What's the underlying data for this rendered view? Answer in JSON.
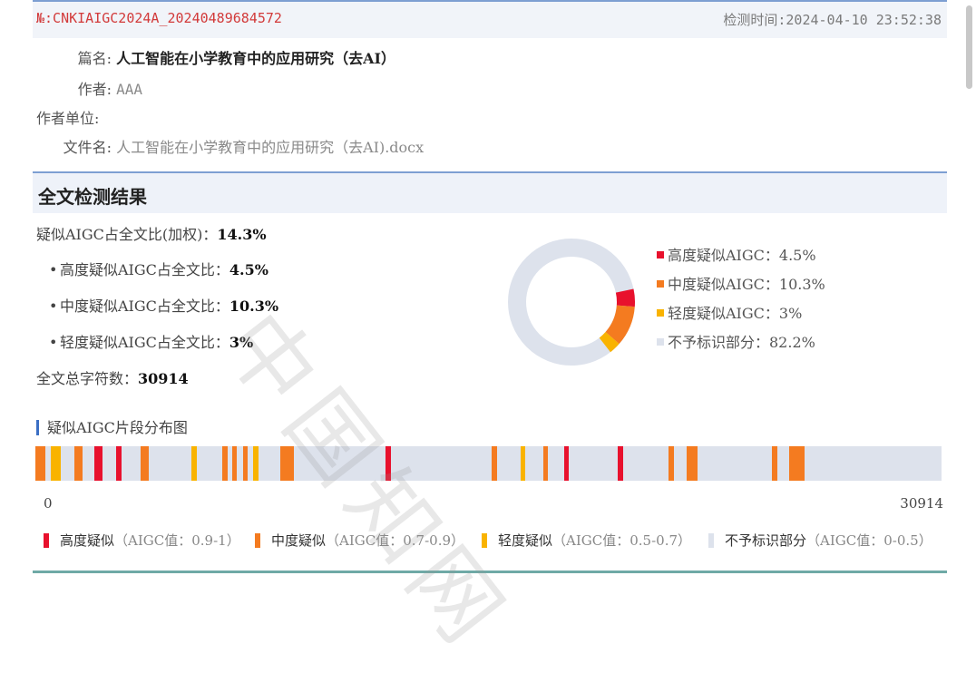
{
  "header": {
    "report_no": "№:CNKIAIGC2024A_20240489684572",
    "detect_time": "检测时间:2024-04-10 23:52:38"
  },
  "info": {
    "title_label": "篇名:",
    "title_value": "人工智能在小学教育中的应用研究（去AI）",
    "author_label": "作者:",
    "author_value": "AAA",
    "unit_label": "作者单位:",
    "unit_value": "",
    "file_label": "文件名:",
    "file_value": "人工智能在小学教育中的应用研究（去AI).docx"
  },
  "section": {
    "title": "全文检测结果"
  },
  "stats": {
    "weighted_label": "疑似AIGC占全文比(加权)：",
    "weighted_value": "14.3%",
    "high_label": "高度疑似AIGC占全文比：",
    "high_value": "4.5%",
    "mid_label": "中度疑似AIGC占全文比：",
    "mid_value": "10.3%",
    "low_label": "轻度疑似AIGC占全文比：",
    "low_value": "3%",
    "chars_label": "全文总字符数：",
    "chars_value": "30914"
  },
  "donut_legend": [
    {
      "label": "高度疑似AIGC：4.5%",
      "color": "#e8112d",
      "value": 4.5
    },
    {
      "label": "中度疑似AIGC：10.3%",
      "color": "#f47b20",
      "value": 10.3
    },
    {
      "label": "轻度疑似AIGC：3%",
      "color": "#f9b300",
      "value": 3
    },
    {
      "label": "不予标识部分：82.2%",
      "color": "#dde2ec",
      "value": 82.2
    }
  ],
  "distribution": {
    "title": "疑似AIGC片段分布图",
    "axis_start": "0",
    "axis_end": "30914",
    "segments": [
      {
        "start": 0.0,
        "end": 0.011,
        "level": "mid"
      },
      {
        "start": 0.017,
        "end": 0.028,
        "level": "low"
      },
      {
        "start": 0.043,
        "end": 0.052,
        "level": "mid"
      },
      {
        "start": 0.065,
        "end": 0.074,
        "level": "high"
      },
      {
        "start": 0.089,
        "end": 0.095,
        "level": "high"
      },
      {
        "start": 0.116,
        "end": 0.125,
        "level": "mid"
      },
      {
        "start": 0.172,
        "end": 0.178,
        "level": "low"
      },
      {
        "start": 0.206,
        "end": 0.212,
        "level": "mid"
      },
      {
        "start": 0.217,
        "end": 0.222,
        "level": "mid"
      },
      {
        "start": 0.229,
        "end": 0.234,
        "level": "mid"
      },
      {
        "start": 0.24,
        "end": 0.246,
        "level": "low"
      },
      {
        "start": 0.27,
        "end": 0.285,
        "level": "mid"
      },
      {
        "start": 0.386,
        "end": 0.392,
        "level": "high"
      },
      {
        "start": 0.504,
        "end": 0.51,
        "level": "mid"
      },
      {
        "start": 0.536,
        "end": 0.541,
        "level": "low"
      },
      {
        "start": 0.561,
        "end": 0.566,
        "level": "mid"
      },
      {
        "start": 0.584,
        "end": 0.589,
        "level": "high"
      },
      {
        "start": 0.643,
        "end": 0.649,
        "level": "high"
      },
      {
        "start": 0.699,
        "end": 0.705,
        "level": "mid"
      },
      {
        "start": 0.719,
        "end": 0.731,
        "level": "mid"
      },
      {
        "start": 0.813,
        "end": 0.819,
        "level": "mid"
      },
      {
        "start": 0.832,
        "end": 0.849,
        "level": "mid"
      }
    ]
  },
  "bottom_legend": [
    {
      "name": "高度疑似",
      "range": "（AIGC值：0.9-1）",
      "color": "#e8112d"
    },
    {
      "name": "中度疑似",
      "range": "（AIGC值：0.7-0.9）",
      "color": "#f47b20"
    },
    {
      "name": "轻度疑似",
      "range": "（AIGC值：0.5-0.7）",
      "color": "#f9b300"
    },
    {
      "name": "不予标识部分",
      "range": "（AIGC值：0-0.5）",
      "color": "#dde2ec"
    }
  ],
  "level_colors": {
    "high": "#e8112d",
    "mid": "#f47b20",
    "low": "#f9b300"
  },
  "watermark": "中国知网"
}
